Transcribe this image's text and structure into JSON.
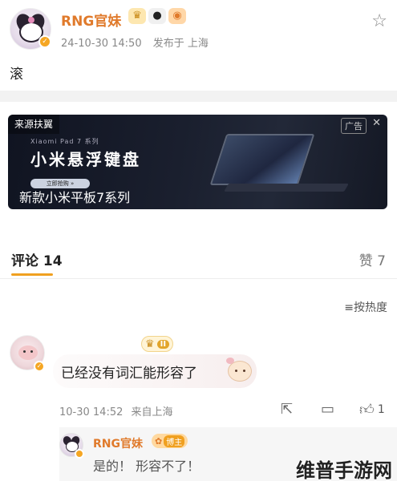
{
  "post": {
    "author": "RNG官妹",
    "timestamp": "24-10-30 14:50",
    "location": "发布于 上海",
    "text": "滚",
    "author_badges": [
      "crown-badge-icon",
      "panda-icon",
      "pet-icon"
    ]
  },
  "ad": {
    "source": "来源扶翼",
    "tag": "广告",
    "close": "✕",
    "subbrand": "Xiaomi Pad 7 系列",
    "headline": "小米悬浮键盘",
    "button": "立即抢购 »",
    "caption": "新款小米平板7系列"
  },
  "comments": {
    "label": "评论 14",
    "likes_label": "赞 7",
    "sort_label": "按热度",
    "sort_icon": "≡"
  },
  "comment": {
    "fan_level": "II",
    "text": "已经没有词汇能形容了",
    "timestamp": "10-30 14:52",
    "location": "来自上海",
    "like_count": "1"
  },
  "reply": {
    "author": "RNG官妹",
    "badge": "博主",
    "text": "是的！ 形容不了！"
  },
  "watermark": "维普手游网",
  "colors": {
    "accent": "#f0a020",
    "author_name": "#e07a2b",
    "meta_text": "#888888"
  }
}
